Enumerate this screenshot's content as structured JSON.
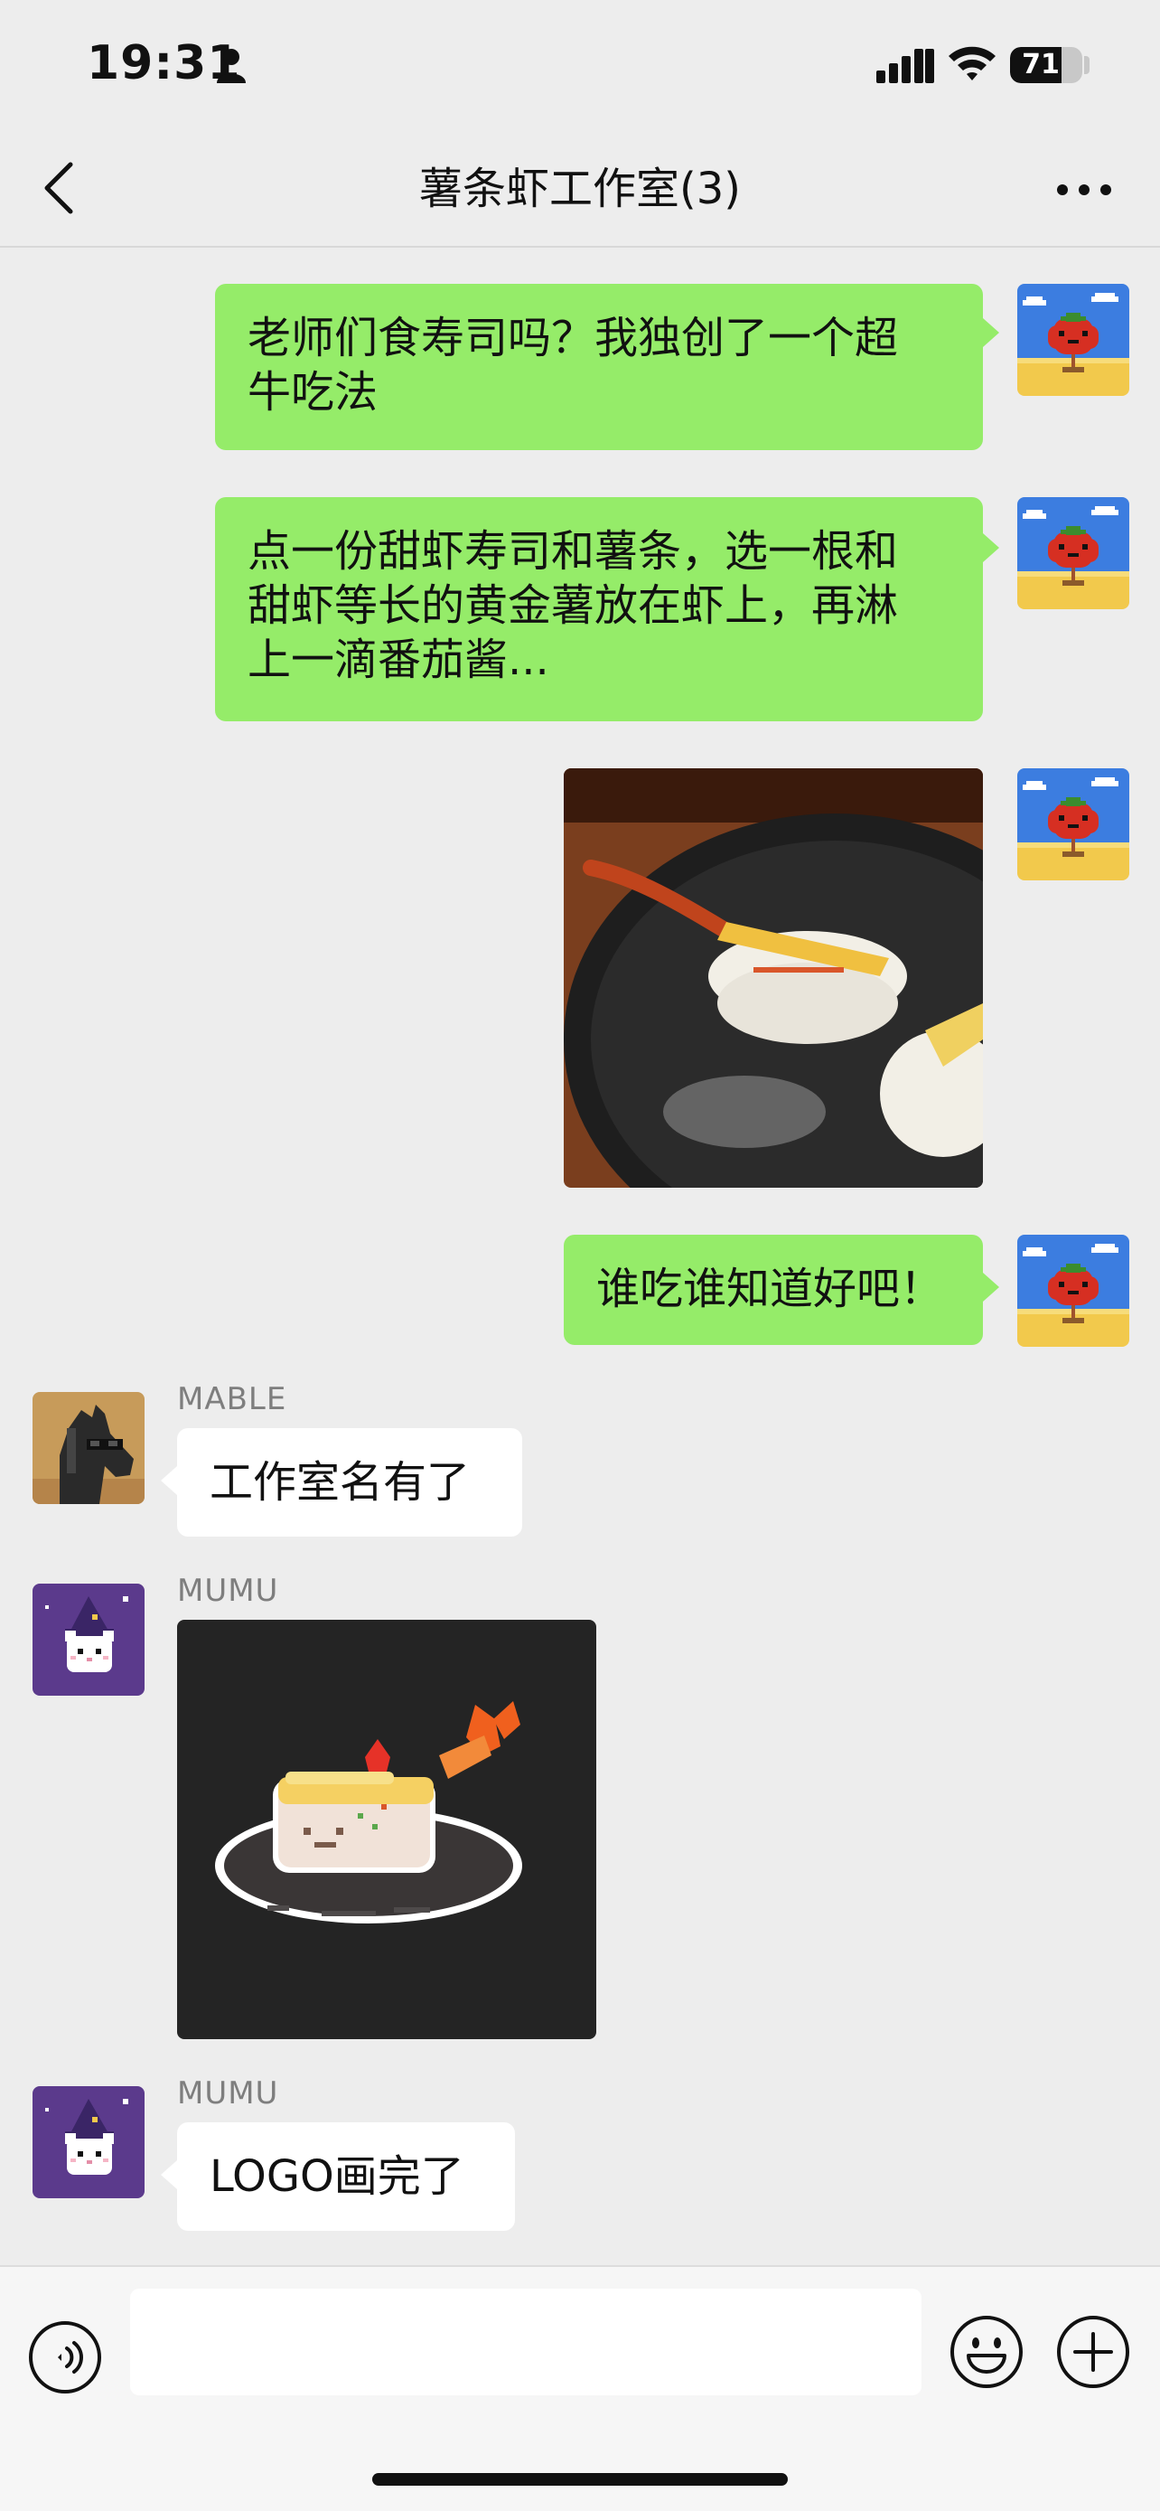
{
  "status_bar": {
    "time": "19:31",
    "battery": "71",
    "battery_level": 0.71
  },
  "header": {
    "title": "薯条虾工作室(3)"
  },
  "messages": [
    {
      "side": "self",
      "type": "text",
      "text_lines": [
        "老师们食寿司吗？我独创了一个超",
        "牛吃法"
      ]
    },
    {
      "side": "self",
      "type": "text",
      "text_lines": [
        "点一份甜虾寿司和薯条，选一根和",
        "甜虾等长的黄金薯放在虾上，再淋",
        "上一滴番茄酱..."
      ]
    },
    {
      "side": "self",
      "type": "image",
      "content": "photo of shrimp sushi topped with a fry on a dark plate"
    },
    {
      "side": "self",
      "type": "text",
      "text": "谁吃谁知道好吧！"
    },
    {
      "side": "other",
      "sender": "MABLE",
      "type": "text",
      "text": "工作室名有了"
    },
    {
      "side": "other",
      "sender": "MUMU",
      "type": "image",
      "content": "pixel art shrimp sushi logo"
    },
    {
      "side": "other",
      "sender": "MUMU",
      "type": "text",
      "text": "LOGO画完了"
    }
  ],
  "input": {
    "placeholder": ""
  },
  "icons": {
    "back": "chevron-left-icon",
    "more": "more-dots-icon",
    "voice": "voice-icon",
    "emoji": "emoji-icon",
    "plus": "plus-icon"
  },
  "colors": {
    "self_bubble": "#95ec69",
    "other_bubble": "#ffffff",
    "background": "#ededed"
  }
}
